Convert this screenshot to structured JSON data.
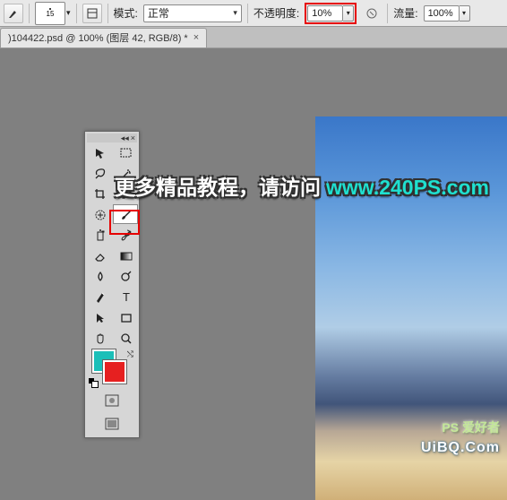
{
  "options_bar": {
    "brush_size": "15",
    "mode_label": "模式:",
    "mode_value": "正常",
    "opacity_label": "不透明度:",
    "opacity_value": "10%",
    "flow_label": "流量:",
    "flow_value": "100%"
  },
  "document_tab": {
    "title": ")104422.psd @ 100% (图层 42, RGB/8) *"
  },
  "tools": {
    "items": [
      {
        "name": "move",
        "glyph": "↖"
      },
      {
        "name": "marquee",
        "glyph": "▭"
      },
      {
        "name": "lasso",
        "glyph": "◉"
      },
      {
        "name": "magic-wand",
        "glyph": "✦"
      },
      {
        "name": "crop",
        "glyph": "✂"
      },
      {
        "name": "eyedropper",
        "glyph": "✎"
      },
      {
        "name": "healing",
        "glyph": "◍"
      },
      {
        "name": "brush",
        "glyph": "🖌"
      },
      {
        "name": "clone",
        "glyph": "▟"
      },
      {
        "name": "history-brush",
        "glyph": "↺"
      },
      {
        "name": "eraser",
        "glyph": "▱"
      },
      {
        "name": "gradient",
        "glyph": "◧"
      },
      {
        "name": "blur",
        "glyph": "◔"
      },
      {
        "name": "dodge",
        "glyph": "◐"
      },
      {
        "name": "pen",
        "glyph": "✒"
      },
      {
        "name": "type",
        "glyph": "T"
      },
      {
        "name": "path-select",
        "glyph": "▸"
      },
      {
        "name": "shape",
        "glyph": "▭"
      },
      {
        "name": "hand",
        "glyph": "✋"
      },
      {
        "name": "zoom",
        "glyph": "🔍"
      }
    ]
  },
  "colors": {
    "foreground": "#1bbfb8",
    "background": "#e62020"
  },
  "watermark": {
    "text": "更多精品教程，请访问",
    "link": "www.240PS.com"
  },
  "branding": {
    "logo": "PS 爱好者",
    "site": "UiBQ.Com"
  }
}
